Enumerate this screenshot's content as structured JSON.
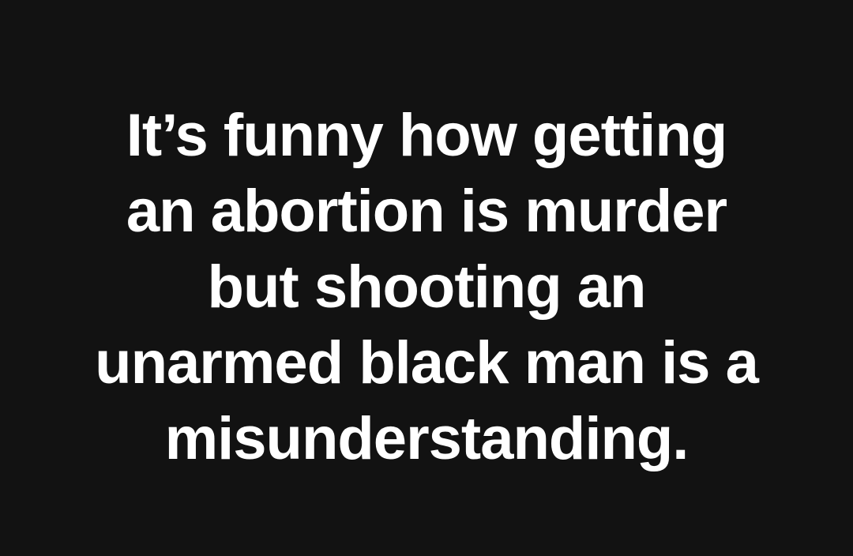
{
  "quote": {
    "lines": [
      "It’s funny how getting",
      "an abortion is murder",
      "but shooting an",
      "unarmed black man is a",
      "misunderstanding."
    ]
  },
  "colors": {
    "background": "#121212",
    "text": "#ffffff"
  }
}
